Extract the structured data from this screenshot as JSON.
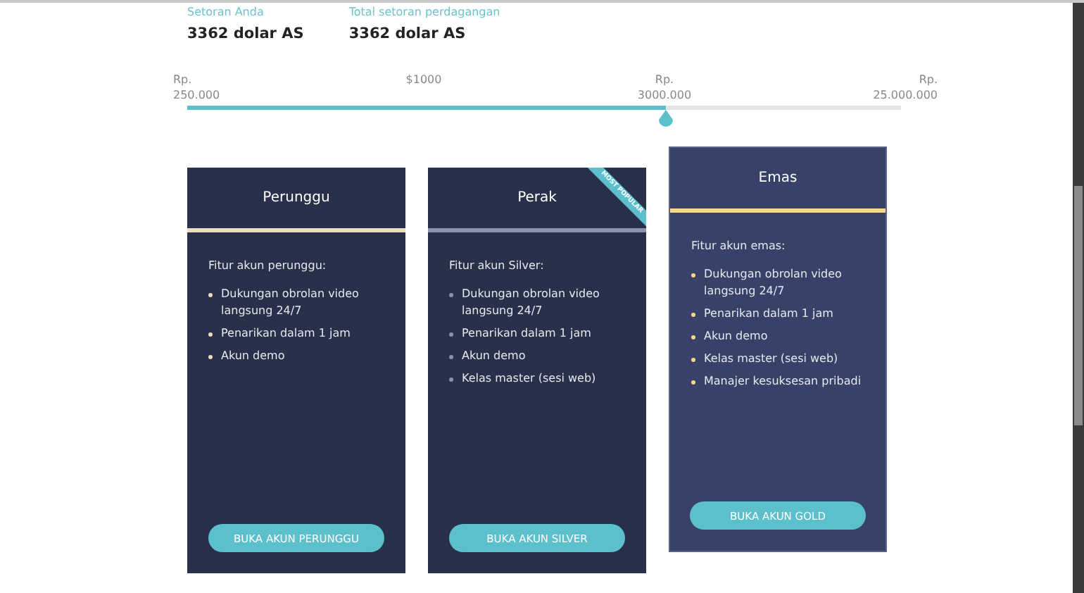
{
  "summary": [
    {
      "label": "Setoran Anda",
      "value": "3362 dolar AS"
    },
    {
      "label": "Total setoran perdagangan",
      "value": "3362 dolar AS"
    }
  ],
  "slider": {
    "level": 0.67,
    "ticks": [
      {
        "label": "Rp. 250.000"
      },
      {
        "label": "$1000"
      },
      {
        "label": "Rp. 3000.000"
      },
      {
        "label": "Rp. 25.000.000"
      }
    ]
  },
  "plans": [
    {
      "name": "Perunggu",
      "color": "#eadcc4",
      "selected": false,
      "features_title": "Fitur akun perunggu:",
      "features": [
        "Dukungan obrolan video langsung 24/7",
        "Penarikan dalam 1 jam",
        "Akun demo"
      ],
      "button": "BUKA AKUN PERUNGGU"
    },
    {
      "name": "Perak",
      "color": "#8c92ac",
      "selected": false,
      "ribbon": "MOST POPULAR",
      "features_title": "Fitur akun Silver:",
      "features": [
        "Dukungan obrolan video langsung 24/7",
        "Penarikan dalam 1 jam",
        "Akun demo",
        "Kelas master (sesi web)"
      ],
      "button": "BUKA AKUN SILVER"
    },
    {
      "name": "Emas",
      "color": "#f5d98a",
      "selected": true,
      "features_title": "Fitur akun emas:",
      "features": [
        "Dukungan obrolan video langsung 24/7",
        "Penarikan dalam 1 jam",
        "Akun demo",
        "Kelas master (sesi web)",
        "Manajer kesuksesan pribadi"
      ],
      "button": "BUKA AKUN GOLD"
    }
  ]
}
